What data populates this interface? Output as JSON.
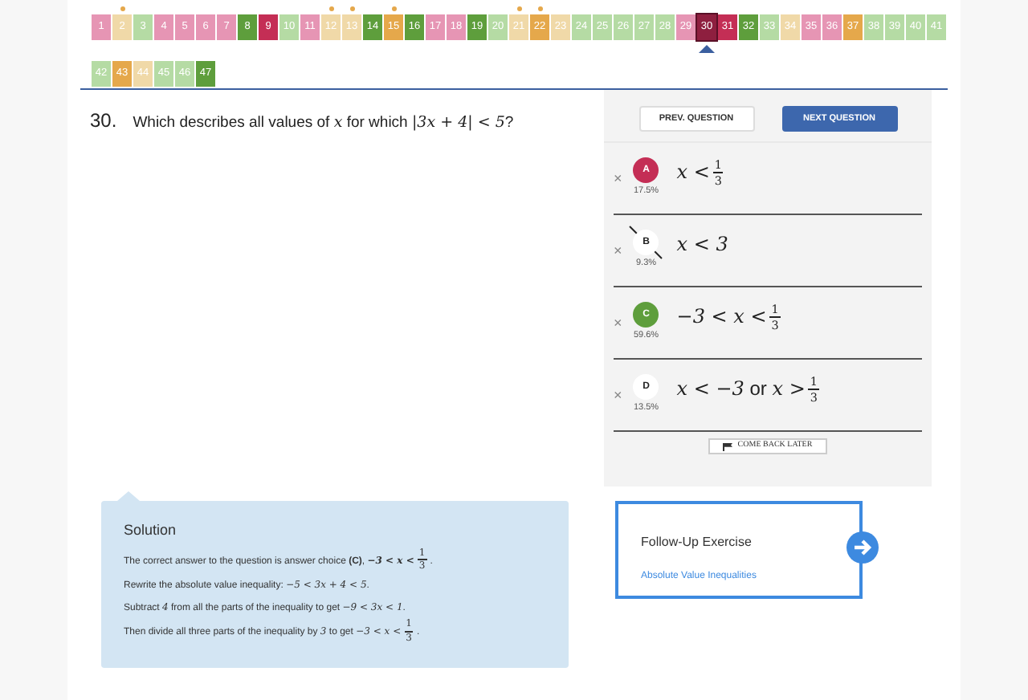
{
  "question_tiles": [
    {
      "label": "1",
      "color": "#e695b4",
      "flagged": false,
      "selected": false
    },
    {
      "label": "2",
      "color": "#f0d9a8",
      "flagged": true,
      "selected": false
    },
    {
      "label": "3",
      "color": "#b5dba4",
      "flagged": false,
      "selected": false
    },
    {
      "label": "4",
      "color": "#e695b4",
      "flagged": false,
      "selected": false
    },
    {
      "label": "5",
      "color": "#e695b4",
      "flagged": false,
      "selected": false
    },
    {
      "label": "6",
      "color": "#e695b4",
      "flagged": false,
      "selected": false
    },
    {
      "label": "7",
      "color": "#e695b4",
      "flagged": false,
      "selected": false
    },
    {
      "label": "8",
      "color": "#5e9e3c",
      "flagged": false,
      "selected": false
    },
    {
      "label": "9",
      "color": "#c42e55",
      "flagged": false,
      "selected": false
    },
    {
      "label": "10",
      "color": "#b5dba4",
      "flagged": false,
      "selected": false
    },
    {
      "label": "11",
      "color": "#e695b4",
      "flagged": false,
      "selected": false
    },
    {
      "label": "12",
      "color": "#f0d9a8",
      "flagged": true,
      "selected": false
    },
    {
      "label": "13",
      "color": "#f0d9a8",
      "flagged": true,
      "selected": false
    },
    {
      "label": "14",
      "color": "#5e9e3c",
      "flagged": false,
      "selected": false
    },
    {
      "label": "15",
      "color": "#e5a84b",
      "flagged": true,
      "selected": false
    },
    {
      "label": "16",
      "color": "#5e9e3c",
      "flagged": false,
      "selected": false
    },
    {
      "label": "17",
      "color": "#e695b4",
      "flagged": false,
      "selected": false
    },
    {
      "label": "18",
      "color": "#e695b4",
      "flagged": false,
      "selected": false
    },
    {
      "label": "19",
      "color": "#5e9e3c",
      "flagged": false,
      "selected": false
    },
    {
      "label": "20",
      "color": "#b5dba4",
      "flagged": false,
      "selected": false
    },
    {
      "label": "21",
      "color": "#f0d9a8",
      "flagged": true,
      "selected": false
    },
    {
      "label": "22",
      "color": "#e5a84b",
      "flagged": true,
      "selected": false
    },
    {
      "label": "23",
      "color": "#f0d9a8",
      "flagged": false,
      "selected": false
    },
    {
      "label": "24",
      "color": "#b5dba4",
      "flagged": false,
      "selected": false
    },
    {
      "label": "25",
      "color": "#b5dba4",
      "flagged": false,
      "selected": false
    },
    {
      "label": "26",
      "color": "#b5dba4",
      "flagged": false,
      "selected": false
    },
    {
      "label": "27",
      "color": "#b5dba4",
      "flagged": false,
      "selected": false
    },
    {
      "label": "28",
      "color": "#b5dba4",
      "flagged": false,
      "selected": false
    },
    {
      "label": "29",
      "color": "#e695b4",
      "flagged": false,
      "selected": false
    },
    {
      "label": "30",
      "color": "#8e1f3f",
      "flagged": false,
      "selected": true
    },
    {
      "label": "31",
      "color": "#c42e55",
      "flagged": false,
      "selected": false
    },
    {
      "label": "32",
      "color": "#5e9e3c",
      "flagged": false,
      "selected": false
    },
    {
      "label": "33",
      "color": "#b5dba4",
      "flagged": false,
      "selected": false
    },
    {
      "label": "34",
      "color": "#f0d9a8",
      "flagged": false,
      "selected": false
    },
    {
      "label": "35",
      "color": "#e695b4",
      "flagged": false,
      "selected": false
    },
    {
      "label": "36",
      "color": "#e695b4",
      "flagged": false,
      "selected": false
    },
    {
      "label": "37",
      "color": "#e5a84b",
      "flagged": false,
      "selected": false
    },
    {
      "label": "38",
      "color": "#b5dba4",
      "flagged": false,
      "selected": false
    },
    {
      "label": "39",
      "color": "#b5dba4",
      "flagged": false,
      "selected": false
    },
    {
      "label": "40",
      "color": "#b5dba4",
      "flagged": false,
      "selected": false
    },
    {
      "label": "41",
      "color": "#b5dba4",
      "flagged": false,
      "selected": false
    },
    {
      "label": "42",
      "color": "#b5dba4",
      "flagged": false,
      "selected": false
    },
    {
      "label": "43",
      "color": "#e5a84b",
      "flagged": false,
      "selected": false
    },
    {
      "label": "44",
      "color": "#f0d9a8",
      "flagged": false,
      "selected": false
    },
    {
      "label": "45",
      "color": "#b5dba4",
      "flagged": false,
      "selected": false
    },
    {
      "label": "46",
      "color": "#b5dba4",
      "flagged": false,
      "selected": false
    },
    {
      "label": "47",
      "color": "#5e9e3c",
      "flagged": false,
      "selected": false
    }
  ],
  "question": {
    "number": "30.",
    "text": [
      {
        "kind": "text",
        "text": "Which describes all values of "
      },
      {
        "kind": "math",
        "text": "x"
      },
      {
        "kind": "text",
        "text": " for which "
      },
      {
        "kind": "math",
        "text": "|3x + 4| < 5"
      },
      {
        "kind": "text",
        "text": "?"
      }
    ]
  },
  "buttons": {
    "prev": "PREV. QUESTION",
    "next": "NEXT QUESTION"
  },
  "choices": [
    {
      "letter": "A",
      "picked": true,
      "correct": false,
      "eliminated": false,
      "percent": "17.5%",
      "expression": [
        {
          "kind": "math",
          "text": "x <"
        },
        {
          "kind": "frac",
          "num": "1",
          "den": "3"
        }
      ],
      "remove": "×"
    },
    {
      "letter": "B",
      "picked": false,
      "correct": false,
      "eliminated": true,
      "percent": "9.3%",
      "expression": [
        {
          "kind": "math",
          "text": "x < 3"
        }
      ],
      "remove": "×"
    },
    {
      "letter": "C",
      "picked": false,
      "correct": true,
      "eliminated": false,
      "percent": "59.6%",
      "expression": [
        {
          "kind": "math",
          "text": "−3 < x <"
        },
        {
          "kind": "frac",
          "num": "1",
          "den": "3"
        }
      ],
      "remove": "×"
    },
    {
      "letter": "D",
      "picked": false,
      "correct": false,
      "eliminated": false,
      "percent": "13.5%",
      "expression": [
        {
          "kind": "math",
          "text": "x < −3"
        },
        {
          "kind": "text",
          "text": " or "
        },
        {
          "kind": "math",
          "text": "x >"
        },
        {
          "kind": "frac",
          "num": "1",
          "den": "3"
        }
      ],
      "remove": "×"
    }
  ],
  "come_back_later": "COME BACK LATER",
  "solution": {
    "title": "Solution",
    "lines": [
      [
        {
          "kind": "text",
          "text": "The correct answer to the question is answer choice "
        },
        {
          "kind": "bold",
          "text": "(C)"
        },
        {
          "kind": "text",
          "text": ", "
        },
        {
          "kind": "mathbold",
          "text": "−3 < x <"
        },
        {
          "kind": "frac",
          "num": "1",
          "den": "3"
        },
        {
          "kind": "text",
          "text": "."
        }
      ],
      [
        {
          "kind": "text",
          "text": "Rewrite the absolute value inequality: "
        },
        {
          "kind": "math",
          "text": "−5 < 3x + 4 < 5"
        },
        {
          "kind": "text",
          "text": "."
        }
      ],
      [
        {
          "kind": "text",
          "text": "Subtract "
        },
        {
          "kind": "math",
          "text": "4"
        },
        {
          "kind": "text",
          "text": " from all the parts of the inequality to get "
        },
        {
          "kind": "math",
          "text": "−9 < 3x < 1"
        },
        {
          "kind": "text",
          "text": "."
        }
      ],
      [
        {
          "kind": "text",
          "text": "Then divide all three parts of the inequality by "
        },
        {
          "kind": "math",
          "text": "3"
        },
        {
          "kind": "text",
          "text": " to get "
        },
        {
          "kind": "math",
          "text": "−3 < x <"
        },
        {
          "kind": "frac",
          "num": "1",
          "den": "3"
        },
        {
          "kind": "text",
          "text": "."
        }
      ]
    ]
  },
  "follow_up": {
    "title": "Follow-Up Exercise",
    "link": "Absolute Value Inequalities"
  }
}
